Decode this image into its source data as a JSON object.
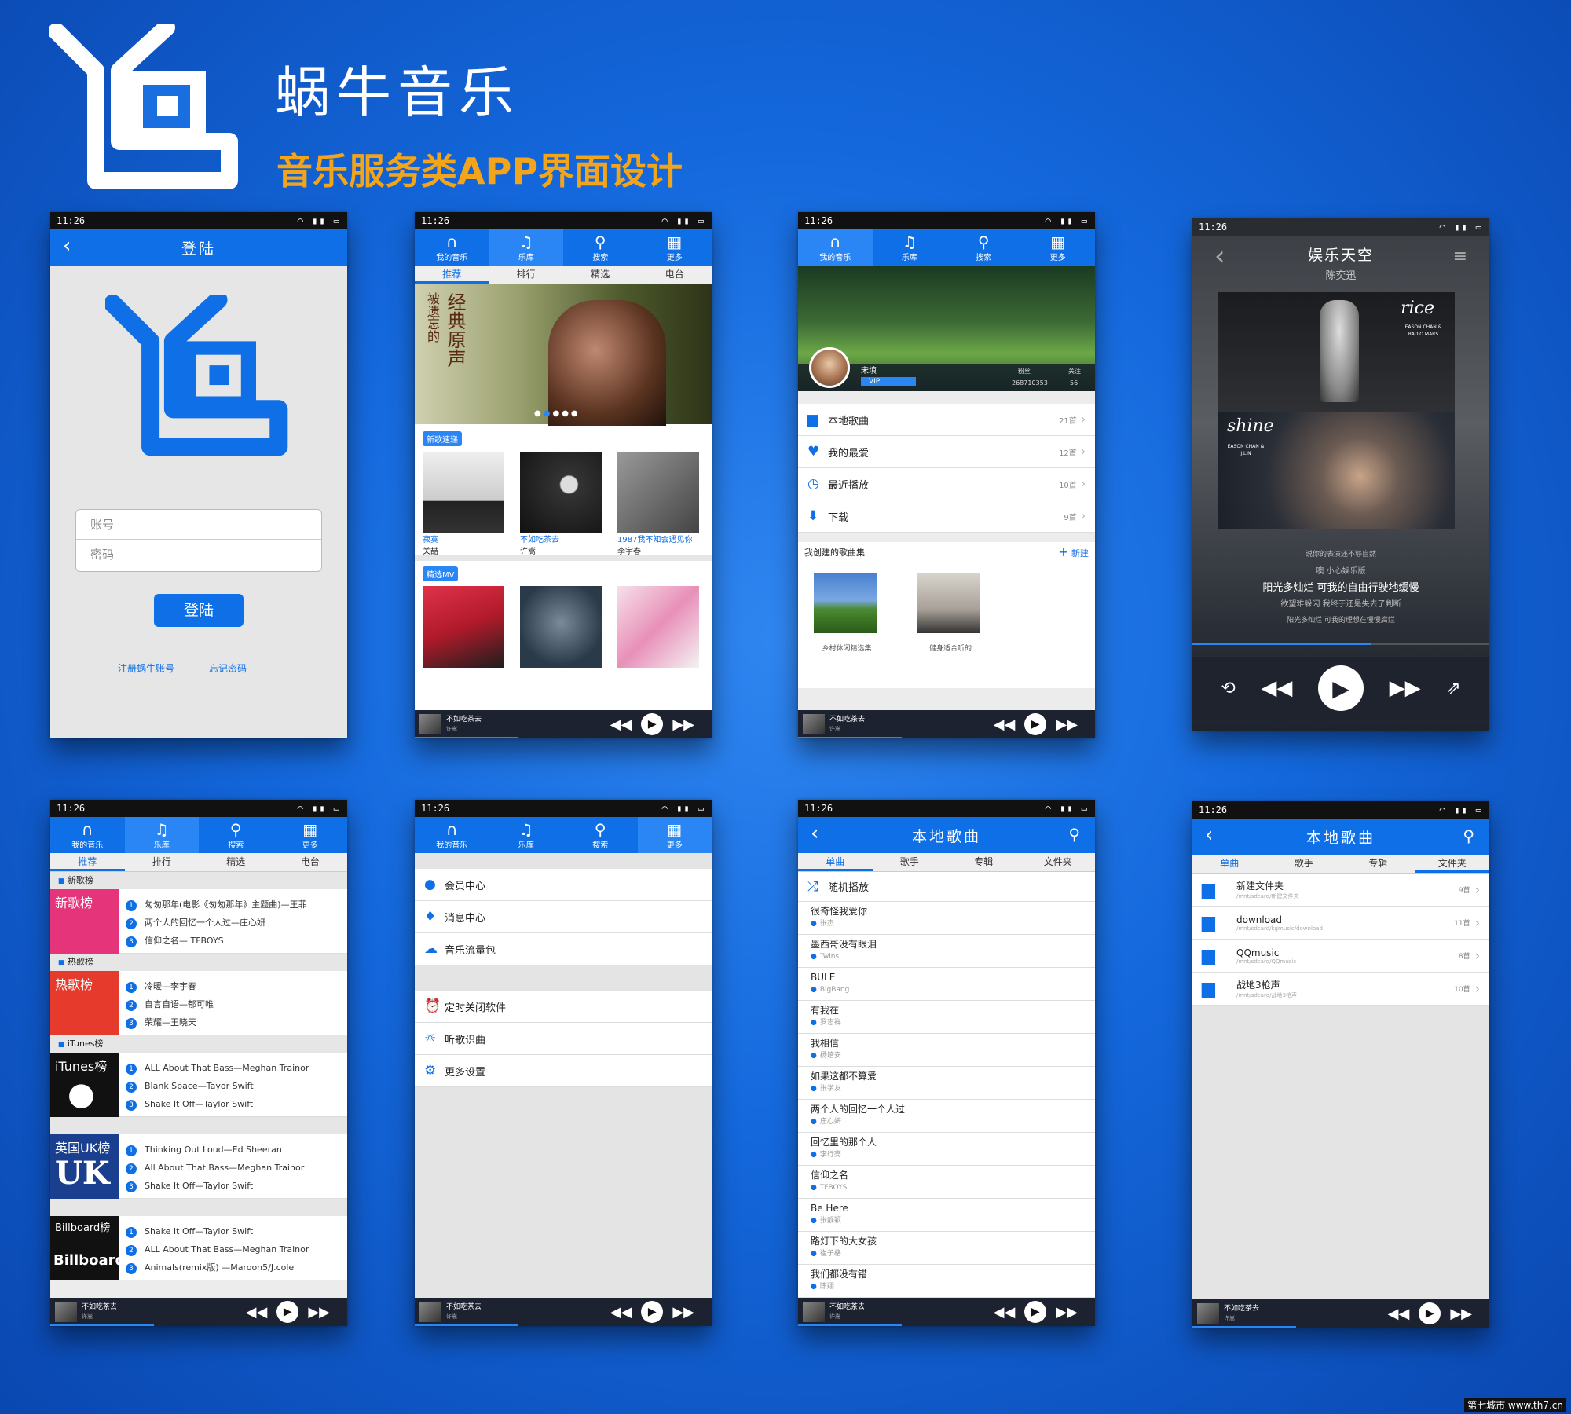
{
  "header": {
    "brand": "蜗牛音乐",
    "tagline": "音乐服务类APP界面设计"
  },
  "status": {
    "time": "11:26"
  },
  "nav": {
    "my_music": "我的音乐",
    "library": "乐库",
    "search": "搜索",
    "more": "更多"
  },
  "subtabs": {
    "recommend": "推荐",
    "rank": "排行",
    "selected": "精选",
    "radio": "电台"
  },
  "login": {
    "title": "登陆",
    "account_placeholder": "账号",
    "password_placeholder": "密码",
    "login_button": "登陆",
    "register": "注册蜗牛账号",
    "forgot": "忘记密码"
  },
  "library": {
    "banner_text": "经典原声",
    "banner_text_side": "被遗忘的",
    "new_album_label": "新歌速递",
    "albums": [
      {
        "title": "寂寞",
        "artist": "关喆"
      },
      {
        "title": "不如吃茶去",
        "artist": "许嵩"
      },
      {
        "title": "1987我不知会遇见你",
        "artist": "李宇春"
      }
    ],
    "mv_label": "精选MV"
  },
  "mymusic": {
    "user_name": "宋填",
    "vip": "VIP",
    "fans_label": "粉丝",
    "fans_value": "268710353",
    "follow_label": "关注",
    "follow_value": "56",
    "items": [
      {
        "label": "本地歌曲",
        "count": "21首"
      },
      {
        "label": "我的最爱",
        "count": "12首"
      },
      {
        "label": "最近播放",
        "count": "10首"
      },
      {
        "label": "下载",
        "count": "9首"
      }
    ],
    "playlists_header": "我创建的歌曲集",
    "new_label": "新建",
    "playlists": [
      {
        "name": "乡村休闲精选集"
      },
      {
        "name": "健身适合听的"
      }
    ]
  },
  "nowplaying": {
    "song": "娱乐天空",
    "artist": "陈奕迅",
    "cover1_text": "rice",
    "cover1_sub": "EASON CHAN & RADIO MARS",
    "cover2_text": "shine",
    "cover2_sub": "EASON CHAN & J.LIN",
    "lyrics": [
      "说你的表演还不够自然",
      "噢  小心娱乐版",
      "阳光多灿烂  可我的自由行驶地缓慢",
      "欲望难躲闪  我终于还是失去了判断",
      "阳光多灿烂  可我的理想在慢慢腐烂"
    ],
    "progress": 0.6
  },
  "ranking": {
    "sections": [
      {
        "header": "新歌榜",
        "cover": "新歌榜",
        "color": "#e6347a",
        "songs": [
          "匆匆那年(电影《匆匆那年》主题曲)—王菲",
          "两个人的回忆一个人过—庄心妍",
          "信仰之名— TFBOYS"
        ]
      },
      {
        "header": "热歌榜",
        "cover": "热歌榜",
        "color": "#e53a2c",
        "songs": [
          "冷暖—李宇春",
          "自言自语—郁可唯",
          "荣耀—王晓天"
        ]
      },
      {
        "header": "iTunes榜",
        "cover": "iTunes榜",
        "color": "#111111",
        "songs": [
          "ALL About That Bass—Meghan Trainor",
          "Blank Space—Tayor Swift",
          "Shake It Off—Taylor Swift"
        ]
      },
      {
        "header": "",
        "cover": "英国UK榜",
        "color": "#1a3f8f",
        "songs": [
          "Thinking Out Loud—Ed Sheeran",
          "All About That Bass—Meghan Trainor",
          "Shake It Off—Taylor Swift"
        ]
      },
      {
        "header": "",
        "cover": "Billboard榜",
        "color": "#111111",
        "songs": [
          "Shake It Off—Taylor Swift",
          "ALL About That Bass—Meghan Trainor",
          "Animals(remix版) —Maroon5/J.cole"
        ]
      }
    ],
    "uk_mark": "UK",
    "billboard_mark": "Billboard"
  },
  "more": {
    "items": [
      {
        "label": "会员中心"
      },
      {
        "label": "消息中心"
      },
      {
        "label": "音乐流量包"
      },
      {
        "label": "定时关闭软件"
      },
      {
        "label": "听歌识曲"
      },
      {
        "label": "更多设置"
      }
    ]
  },
  "local": {
    "title": "本地歌曲",
    "tabs": [
      "单曲",
      "歌手",
      "专辑",
      "文件夹"
    ],
    "shuffle": "随机播放",
    "songs": [
      {
        "name": "很奇怪我爱你",
        "artist": "张杰"
      },
      {
        "name": "墨西哥没有眼泪",
        "artist": "Twins"
      },
      {
        "name": "BULE",
        "artist": "BigBang"
      },
      {
        "name": "有我在",
        "artist": "罗志祥"
      },
      {
        "name": "我相信",
        "artist": "杨培安"
      },
      {
        "name": "如果这都不算爱",
        "artist": "张学友"
      },
      {
        "name": "两个人的回忆一个人过",
        "artist": "庄心妍"
      },
      {
        "name": "回忆里的那个人",
        "artist": "李行亮"
      },
      {
        "name": "信仰之名",
        "artist": "TFBOYS"
      },
      {
        "name": "Be Here",
        "artist": "张靓颖"
      },
      {
        "name": "路灯下的大女孩",
        "artist": "崔子格"
      },
      {
        "name": "我们都没有错",
        "artist": "陈翔"
      }
    ],
    "folders": [
      {
        "name": "新建文件夹",
        "path": "/mnt/sdcard/新建文件夹",
        "count": "9首"
      },
      {
        "name": "download",
        "path": "/mnt/sdcard/kgmusic/download",
        "count": "11首"
      },
      {
        "name": "QQmusic",
        "path": "/mnt/sdcard/QQmusic",
        "count": "8首"
      },
      {
        "name": "战地3枪声",
        "path": "/mnt/sdcard/战地3枪声",
        "count": "10首"
      }
    ]
  },
  "miniplayer": {
    "song": "不如吃茶去",
    "artist": "许嵩"
  },
  "watermark": "第七城市  www.th7.cn"
}
